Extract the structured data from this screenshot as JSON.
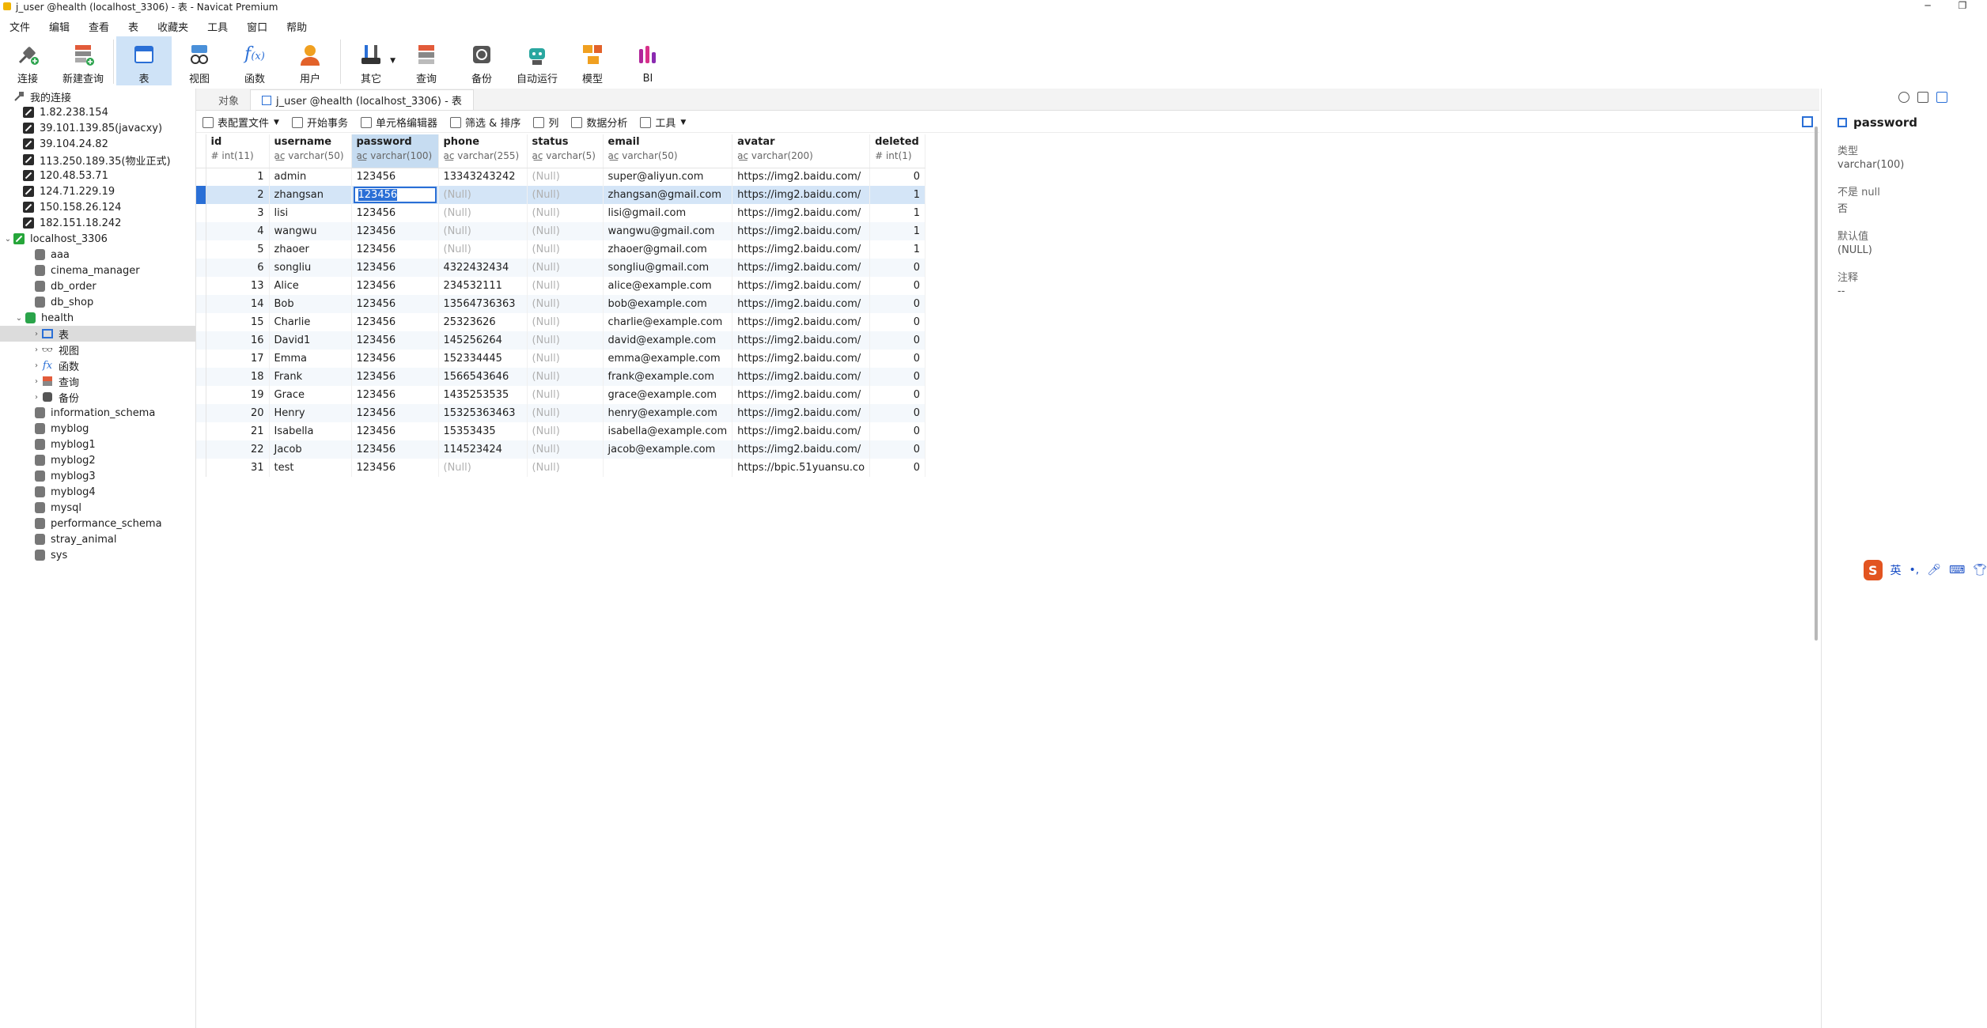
{
  "window": {
    "title": "j_user @health (localhost_3306) - 表 - Navicat Premium"
  },
  "menu": [
    "文件",
    "编辑",
    "查看",
    "表",
    "收藏夹",
    "工具",
    "窗口",
    "帮助"
  ],
  "toolbar": {
    "items": [
      {
        "label": "连接",
        "icon": "plug-icon"
      },
      {
        "label": "新建查询",
        "icon": "new-query-icon"
      },
      {
        "label": "表",
        "icon": "table-icon",
        "active": true
      },
      {
        "label": "视图",
        "icon": "view-icon"
      },
      {
        "label": "函数",
        "icon": "function-icon"
      },
      {
        "label": "用户",
        "icon": "user-icon"
      },
      {
        "label": "其它",
        "icon": "tools-icon"
      },
      {
        "label": "查询",
        "icon": "query-icon"
      },
      {
        "label": "备份",
        "icon": "backup-icon"
      },
      {
        "label": "自动运行",
        "icon": "robot-icon"
      },
      {
        "label": "模型",
        "icon": "model-icon"
      },
      {
        "label": "BI",
        "icon": "bi-icon"
      }
    ]
  },
  "sidebar": {
    "root": "我的连接",
    "connections": [
      "1.82.238.154",
      "39.101.139.85(javacxy)",
      "39.104.24.82",
      "113.250.189.35(物业正式)",
      "120.48.53.71",
      "124.71.229.19",
      "150.158.26.124",
      "182.151.18.242"
    ],
    "localhost": "localhost_3306",
    "databases_before": [
      "aaa",
      "cinema_manager",
      "db_order",
      "db_shop"
    ],
    "health": "health",
    "health_children": [
      "表",
      "视图",
      "函数",
      "查询",
      "备份"
    ],
    "databases_after": [
      "information_schema",
      "myblog",
      "myblog1",
      "myblog2",
      "myblog3",
      "myblog4",
      "mysql",
      "performance_schema",
      "stray_animal",
      "sys"
    ]
  },
  "tabs": {
    "objects": "对象",
    "current": "j_user @health (localhost_3306) - 表"
  },
  "subtoolbar": [
    "表配置文件",
    "开始事务",
    "单元格编辑器",
    "筛选 & 排序",
    "列",
    "数据分析",
    "工具"
  ],
  "grid": {
    "columns": [
      {
        "name": "id",
        "type": "int(11)"
      },
      {
        "name": "username",
        "type": "varchar(50)"
      },
      {
        "name": "password",
        "type": "varchar(100)"
      },
      {
        "name": "phone",
        "type": "varchar(255)"
      },
      {
        "name": "status",
        "type": "varchar(5)"
      },
      {
        "name": "email",
        "type": "varchar(50)"
      },
      {
        "name": "avatar",
        "type": "varchar(200)"
      },
      {
        "name": "deleted",
        "type": "int(1)"
      }
    ],
    "rows": [
      [
        "1",
        "admin",
        "123456",
        "13343243242",
        "(Null)",
        "super@aliyun.com",
        "https://img2.baidu.com/",
        "0"
      ],
      [
        "2",
        "zhangsan",
        "123456",
        "(Null)",
        "(Null)",
        "zhangsan@gmail.com",
        "https://img2.baidu.com/",
        "1"
      ],
      [
        "3",
        "lisi",
        "123456",
        "(Null)",
        "(Null)",
        "lisi@gmail.com",
        "https://img2.baidu.com/",
        "1"
      ],
      [
        "4",
        "wangwu",
        "123456",
        "(Null)",
        "(Null)",
        "wangwu@gmail.com",
        "https://img2.baidu.com/",
        "1"
      ],
      [
        "5",
        "zhaoer",
        "123456",
        "(Null)",
        "(Null)",
        "zhaoer@gmail.com",
        "https://img2.baidu.com/",
        "1"
      ],
      [
        "6",
        "songliu",
        "123456",
        "4322432434",
        "(Null)",
        "songliu@gmail.com",
        "https://img2.baidu.com/",
        "0"
      ],
      [
        "13",
        "Alice",
        "123456",
        "234532111",
        "(Null)",
        "alice@example.com",
        "https://img2.baidu.com/",
        "0"
      ],
      [
        "14",
        "Bob",
        "123456",
        "13564736363",
        "(Null)",
        "bob@example.com",
        "https://img2.baidu.com/",
        "0"
      ],
      [
        "15",
        "Charlie",
        "123456",
        "25323626",
        "(Null)",
        "charlie@example.com",
        "https://img2.baidu.com/",
        "0"
      ],
      [
        "16",
        "David1",
        "123456",
        "145256264",
        "(Null)",
        "david@example.com",
        "https://img2.baidu.com/",
        "0"
      ],
      [
        "17",
        "Emma",
        "123456",
        "152334445",
        "(Null)",
        "emma@example.com",
        "https://img2.baidu.com/",
        "0"
      ],
      [
        "18",
        "Frank",
        "123456",
        "1566543646",
        "(Null)",
        "frank@example.com",
        "https://img2.baidu.com/",
        "0"
      ],
      [
        "19",
        "Grace",
        "123456",
        "1435253535",
        "(Null)",
        "grace@example.com",
        "https://img2.baidu.com/",
        "0"
      ],
      [
        "20",
        "Henry",
        "123456",
        "15325363463",
        "(Null)",
        "henry@example.com",
        "https://img2.baidu.com/",
        "0"
      ],
      [
        "21",
        "Isabella",
        "123456",
        "15353435",
        "(Null)",
        "isabella@example.com",
        "https://img2.baidu.com/",
        "0"
      ],
      [
        "22",
        "Jacob",
        "123456",
        "114523424",
        "(Null)",
        "jacob@example.com",
        "https://img2.baidu.com/",
        "0"
      ],
      [
        "31",
        "test",
        "123456",
        "(Null)",
        "(Null)",
        "",
        "https://bpic.51yuansu.co",
        "0"
      ]
    ],
    "selected_row": 1,
    "selected_column": 2
  },
  "inspector": {
    "field": "password",
    "type_label": "类型",
    "type_value": "varchar(100)",
    "notnull_label": "不是 null",
    "notnull_value": "否",
    "default_label": "默认值",
    "default_value": "(NULL)",
    "comment_label": "注释",
    "comment_value": "--"
  },
  "ime": {
    "lang": "英"
  },
  "colors": {
    "accent": "#2a6fd6",
    "selection": "#d4e5f7",
    "header_highlight": "#c6dcf1"
  }
}
